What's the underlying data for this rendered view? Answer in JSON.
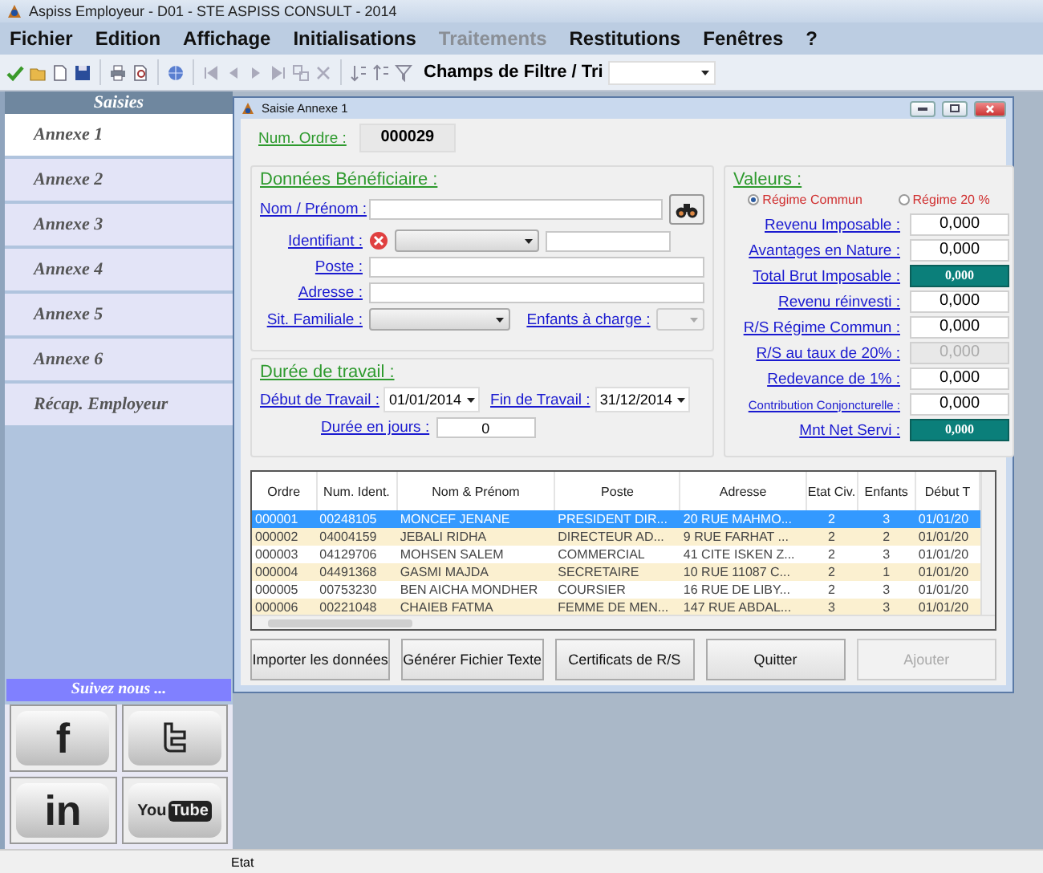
{
  "window": {
    "title": "Aspiss Employeur - D01 - STE ASPISS CONSULT - 2014"
  },
  "menu": [
    {
      "label": "Fichier",
      "disabled": false
    },
    {
      "label": "Edition",
      "disabled": false
    },
    {
      "label": "Affichage",
      "disabled": false
    },
    {
      "label": "Initialisations",
      "disabled": false
    },
    {
      "label": "Traitements",
      "disabled": true
    },
    {
      "label": "Restitutions",
      "disabled": false
    },
    {
      "label": "Fenêtres",
      "disabled": false
    },
    {
      "label": "?",
      "disabled": false
    }
  ],
  "toolbar": {
    "filter_label": "Champs de Filtre / Tri"
  },
  "sidebar": {
    "title": "Saisies",
    "items": [
      {
        "label": "Annexe 1",
        "selected": true
      },
      {
        "label": "Annexe 2",
        "selected": false
      },
      {
        "label": "Annexe 3",
        "selected": false
      },
      {
        "label": "Annexe 4",
        "selected": false
      },
      {
        "label": "Annexe 5",
        "selected": false
      },
      {
        "label": "Annexe 6",
        "selected": false
      },
      {
        "label": "Récap. Employeur",
        "selected": false
      }
    ]
  },
  "social": {
    "title": "Suivez nous ...",
    "buttons": [
      {
        "kind": "facebook",
        "glyph": "f"
      },
      {
        "kind": "twitter"
      },
      {
        "kind": "linkedin",
        "glyph": "in"
      },
      {
        "kind": "youtube",
        "text_1": "You",
        "text_2": "Tube"
      }
    ]
  },
  "dialog": {
    "title": "Saisie Annexe 1",
    "num_ordre": {
      "label": "Num. Ordre :",
      "value": "000029"
    },
    "beneficiaire": {
      "title": "Données Bénéficiaire :",
      "nom_label": "Nom / Prénom :",
      "identifiant_label": "Identifiant :",
      "poste_label": "Poste :",
      "adresse_label": "Adresse :",
      "situation_label": "Sit. Familiale :",
      "enfants_label": "Enfants à charge :"
    },
    "duree": {
      "title": "Durée de travail :",
      "debut_label": "Début de Travail :",
      "debut_value": "01/01/2014",
      "fin_label": "Fin de Travail :",
      "fin_value": "31/12/2014",
      "jours_label": "Durée en jours :",
      "jours_value": "0"
    },
    "valeurs": {
      "title": "Valeurs :",
      "regimes": [
        {
          "label": "Régime Commun",
          "selected": true
        },
        {
          "label": "Régime 20 %",
          "selected": false
        }
      ],
      "rows": [
        {
          "label": "Revenu Imposable :",
          "value": "0,000",
          "kind": "input"
        },
        {
          "label": "Avantages en Nature :",
          "value": "0,000",
          "kind": "input"
        },
        {
          "label": "Total Brut Imposable :",
          "value": "0,000",
          "kind": "total"
        },
        {
          "label": "Revenu réinvesti :",
          "value": "0,000",
          "kind": "input"
        },
        {
          "label": "R/S Régime Commun :",
          "value": "0,000",
          "kind": "input"
        },
        {
          "label": "R/S au taux de 20% :",
          "value": "0,000",
          "kind": "disabled"
        },
        {
          "label": "Redevance de 1% :",
          "value": "0,000",
          "kind": "input"
        },
        {
          "label": "Contribution Conjoncturelle :",
          "value": "0,000",
          "kind": "small"
        },
        {
          "label": "Mnt Net Servi :",
          "value": "0,000",
          "kind": "total"
        }
      ]
    },
    "table": {
      "columns": [
        "Ordre",
        "Num. Ident.",
        "Nom & Prénom",
        "Poste",
        "Adresse",
        "Etat Civ.",
        "Enfants",
        "Début T"
      ],
      "rows": [
        {
          "selected": true,
          "cells": [
            "000001",
            "00248105",
            "MONCEF JENANE",
            "PRESIDENT DIR...",
            "20 RUE MAHMO...",
            "2",
            "3",
            "01/01/20"
          ]
        },
        {
          "selected": false,
          "cells": [
            "000002",
            "04004159",
            "JEBALI RIDHA",
            "DIRECTEUR AD...",
            "9 RUE FARHAT ...",
            "2",
            "2",
            "01/01/20"
          ]
        },
        {
          "selected": false,
          "cells": [
            "000003",
            "04129706",
            "MOHSEN SALEM",
            "COMMERCIAL",
            "41 CITE ISKEN Z...",
            "2",
            "3",
            "01/01/20"
          ]
        },
        {
          "selected": false,
          "cells": [
            "000004",
            "04491368",
            "GASMI MAJDA",
            "SECRETAIRE",
            "10 RUE 11087 C...",
            "2",
            "1",
            "01/01/20"
          ]
        },
        {
          "selected": false,
          "cells": [
            "000005",
            "00753230",
            "BEN AICHA MONDHER",
            "COURSIER",
            "16 RUE DE LIBY...",
            "2",
            "3",
            "01/01/20"
          ]
        },
        {
          "selected": false,
          "cells": [
            "000006",
            "00221048",
            "CHAIEB FATMA",
            "FEMME DE MEN...",
            "147 RUE ABDAL...",
            "3",
            "3",
            "01/01/20"
          ]
        }
      ]
    },
    "buttons": [
      {
        "label": "Importer les données",
        "disabled": false
      },
      {
        "label": "Générer Fichier Texte",
        "disabled": false
      },
      {
        "label": "Certificats de R/S",
        "disabled": false
      },
      {
        "label": "Quitter",
        "disabled": false
      },
      {
        "label": "Ajouter",
        "disabled": true
      }
    ]
  },
  "status_bar": {
    "text": "Etat"
  }
}
